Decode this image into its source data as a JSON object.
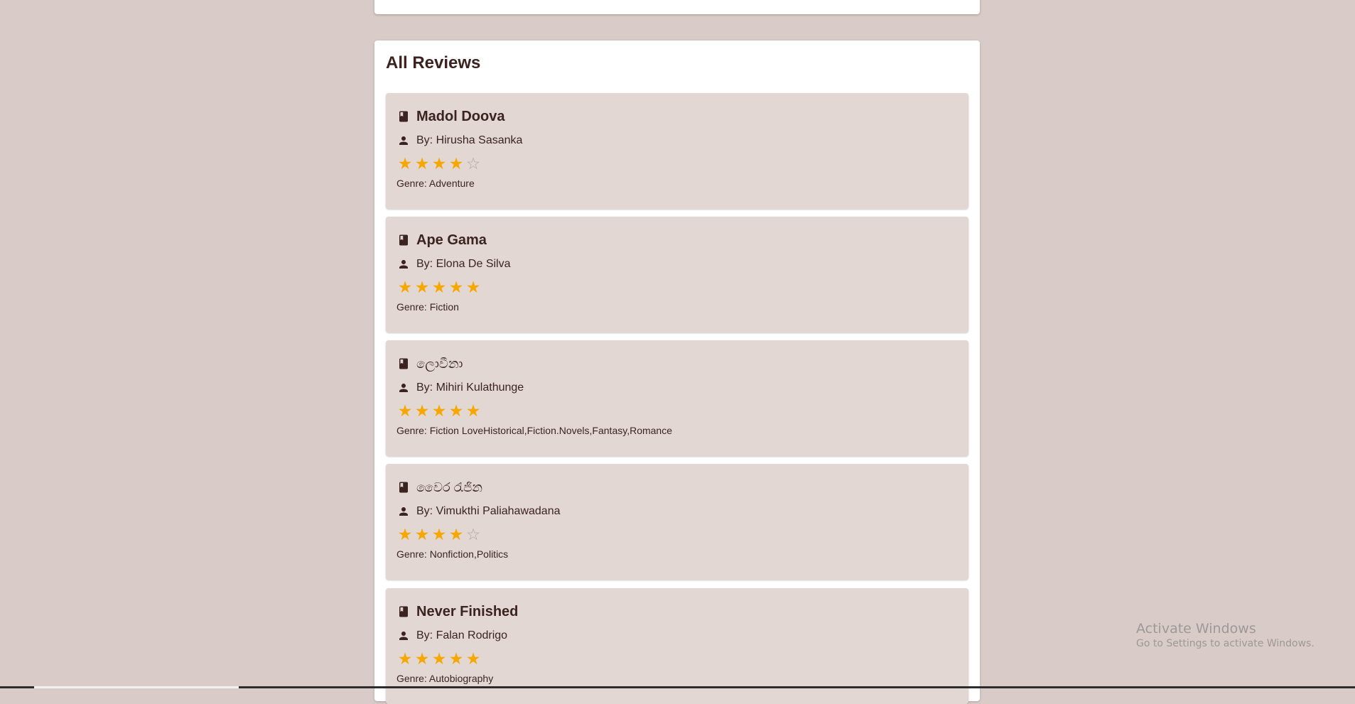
{
  "panel": {
    "title": "All Reviews"
  },
  "reviews": [
    {
      "title": "Madol Doova",
      "author": "By: Hirusha Sasanka",
      "rating": 4,
      "genre": "Genre: Adventure"
    },
    {
      "title": "Ape Gama",
      "author": "By: Elona De Silva",
      "rating": 5,
      "genre": "Genre: Fiction"
    },
    {
      "title": "ලොවීනා",
      "author": "By: Mihiri Kulathunge",
      "rating": 5,
      "genre": "Genre: Fiction LoveHistorical,Fiction.Novels,Fantasy,Romance"
    },
    {
      "title": "වෛර රැජින",
      "author": "By: Vimukthi Paliahawadana",
      "rating": 4,
      "genre": "Genre: Nonfiction,Politics"
    },
    {
      "title": "Never Finished",
      "author": "By: Falan Rodrigo",
      "rating": 5,
      "genre": "Genre: Autobiography"
    }
  ],
  "rating_max": 5,
  "icons": {
    "book": "book-icon",
    "author": "person-icon",
    "star": "star-icon"
  },
  "colors": {
    "star_filled": "#f6a800",
    "star_empty": "#b1a6a3",
    "text": "#3b2320",
    "card": "#e2d7d3",
    "background": "#d9cbc8"
  },
  "watermark": {
    "title": "Activate Windows",
    "subtitle": "Go to Settings to activate Windows."
  }
}
